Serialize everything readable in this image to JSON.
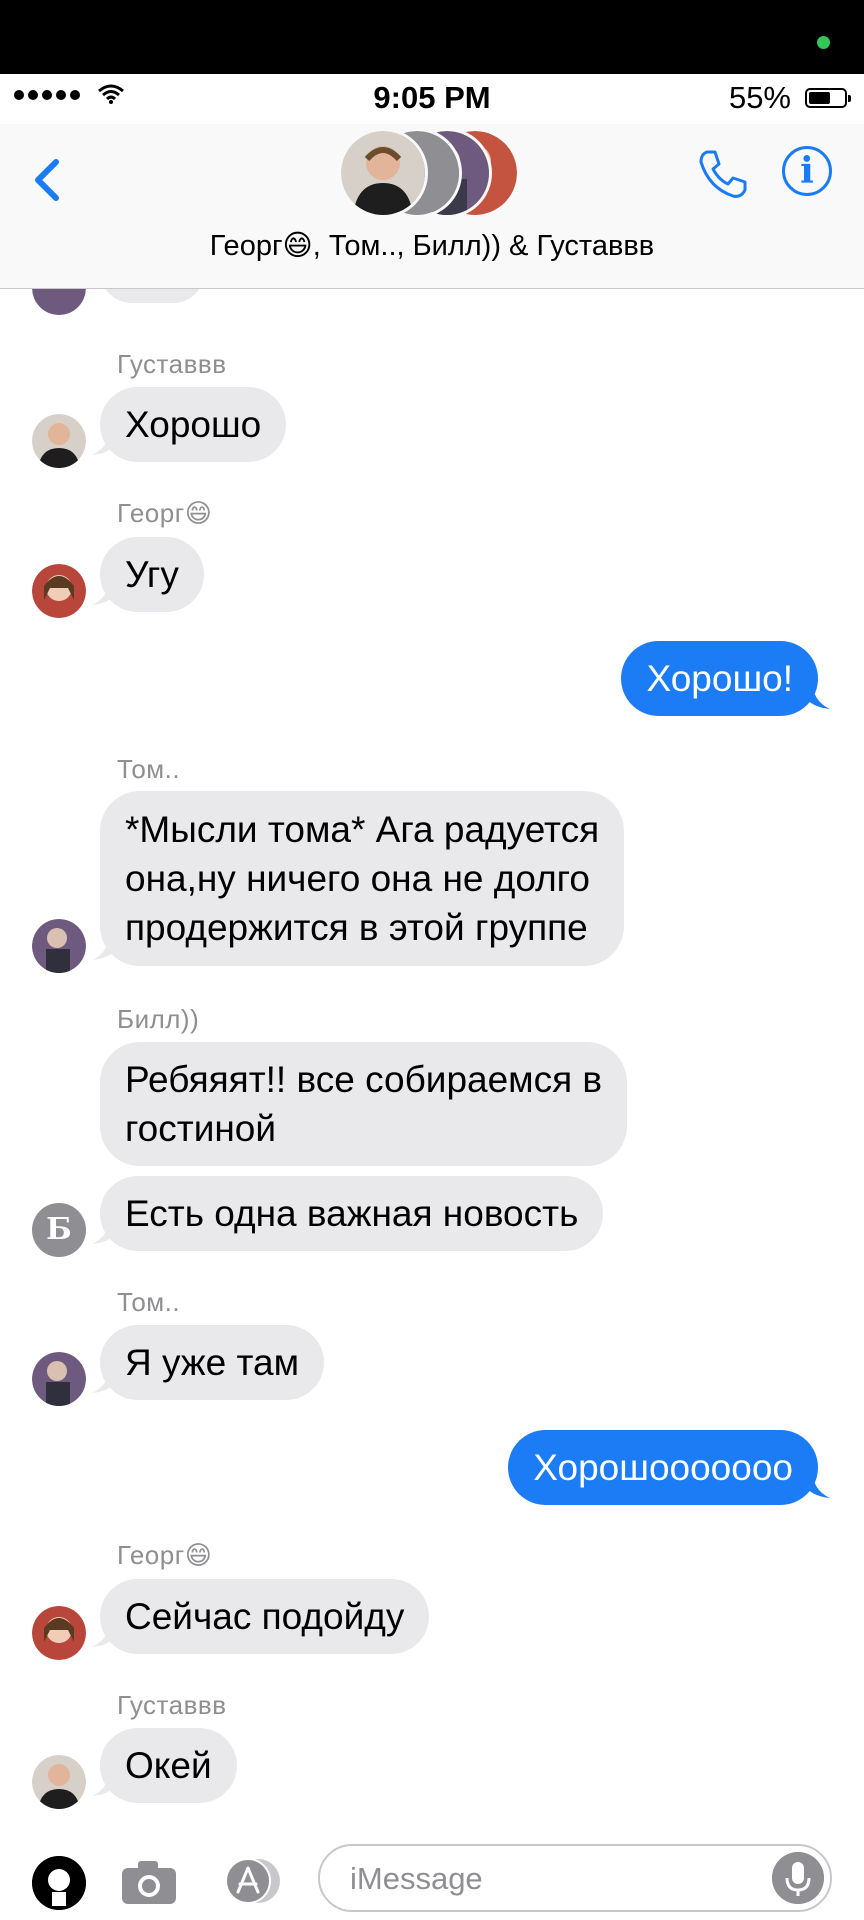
{
  "status": {
    "time": "9:05 PM",
    "battery": "55%",
    "battery_level": 0.55
  },
  "header": {
    "group_name": "Георг😄, Том.., Билл)) & Густаввв",
    "back_icon": "chevron-left-icon",
    "call_icon": "phone-icon",
    "info_label": "i"
  },
  "messages": [
    {
      "sender": "Густаввв",
      "text": "Хорошо",
      "direction": "in"
    },
    {
      "sender": "Георг😄",
      "text": "Угу",
      "direction": "in"
    },
    {
      "text": "Хорошо!",
      "direction": "out"
    },
    {
      "sender": "Том..",
      "lines": [
        "*Мысли тома* Ага радуется",
        "она,ну ничего она не долго",
        "продержится в этой группе"
      ],
      "direction": "in"
    },
    {
      "sender": "Билл))",
      "lines": [
        "Ребяяят!! все собираемся в",
        "гостиной"
      ],
      "direction": "in"
    },
    {
      "text": "Есть одна важная новость",
      "direction": "in",
      "avatar_letter": "Б"
    },
    {
      "sender": "Том..",
      "text": "Я уже там",
      "direction": "in"
    },
    {
      "text": "Хорошооооооо",
      "direction": "out"
    },
    {
      "sender": "Георг😄",
      "text": "Сейчас подойду",
      "direction": "in"
    },
    {
      "sender": "Густаввв",
      "text": "Окей",
      "direction": "in"
    }
  ],
  "input": {
    "placeholder": "iMessage"
  },
  "colors": {
    "accent": "#1b7cf5",
    "incoming_bubble": "#e9e9eb",
    "sender_text": "#8e8e93",
    "recording_dot": "#33c759"
  }
}
